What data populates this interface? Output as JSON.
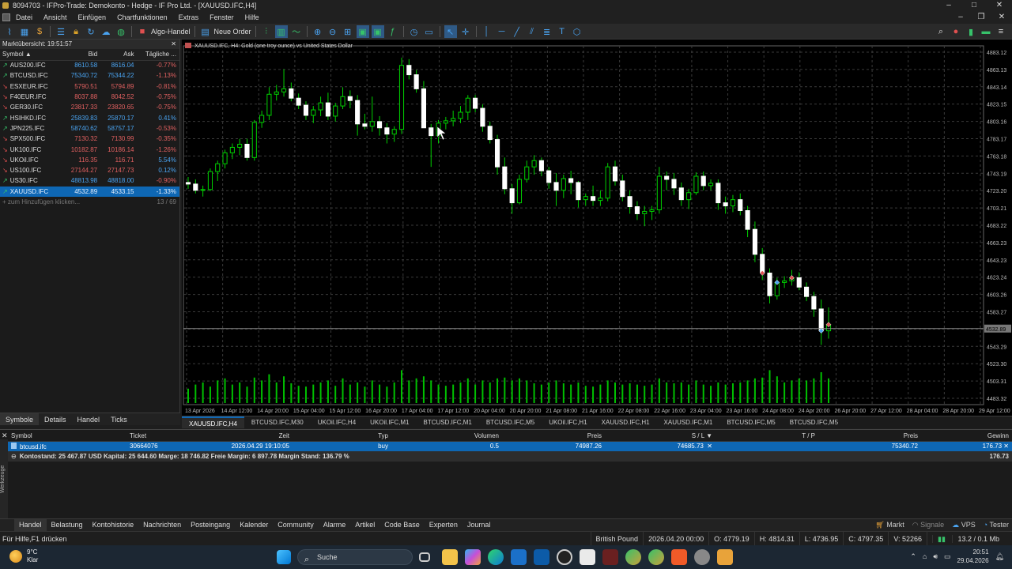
{
  "window": {
    "title": "8094703 - IFPro-Trade: Demokonto - Hedge - IF Pro Ltd. - [XAUUSD.IFC,H4]",
    "controls": [
      "–",
      "□",
      "✕"
    ]
  },
  "menu": {
    "items": [
      "Datei",
      "Ansicht",
      "Einfügen",
      "Chartfunktionen",
      "Extras",
      "Fenster",
      "Hilfe"
    ]
  },
  "toolbar": {
    "algo_label": "Algo-Handel",
    "order_label": "Neue Order"
  },
  "market_watch": {
    "header": "Marktübersicht: 19:51:57",
    "columns": [
      "Symbol",
      "Bid",
      "Ask",
      "Tägliche ..."
    ],
    "rows": [
      {
        "symbol": "AUS200.IFC",
        "bid": "8610.58",
        "ask": "8616.04",
        "change": "-0.77%",
        "dir": "up",
        "cdir": "dn"
      },
      {
        "symbol": "BTCUSD.IFC",
        "bid": "75340.72",
        "ask": "75344.22",
        "change": "-1.13%",
        "dir": "up",
        "cdir": "dn"
      },
      {
        "symbol": "ESXEUR.IFC",
        "bid": "5790.51",
        "ask": "5794.89",
        "change": "-0.81%",
        "dir": "dn",
        "cdir": "dn"
      },
      {
        "symbol": "F40EUR.IFC",
        "bid": "8037.88",
        "ask": "8042.52",
        "change": "-0.75%",
        "dir": "dn",
        "cdir": "dn"
      },
      {
        "symbol": "GER30.IFC",
        "bid": "23817.33",
        "ask": "23820.65",
        "change": "-0.75%",
        "dir": "dn",
        "cdir": "dn"
      },
      {
        "symbol": "HSIHKD.IFC",
        "bid": "25839.83",
        "ask": "25870.17",
        "change": "0.41%",
        "dir": "nn",
        "cdir": "up"
      },
      {
        "symbol": "JPN225.IFC",
        "bid": "58740.62",
        "ask": "58757.17",
        "change": "-0.53%",
        "dir": "up",
        "cdir": "dn"
      },
      {
        "symbol": "SPX500.IFC",
        "bid": "7130.32",
        "ask": "7130.99",
        "change": "-0.35%",
        "dir": "dn",
        "cdir": "dn"
      },
      {
        "symbol": "UK100.IFC",
        "bid": "10182.87",
        "ask": "10186.14",
        "change": "-1.26%",
        "dir": "dn",
        "cdir": "dn"
      },
      {
        "symbol": "UKOil.IFC",
        "bid": "116.35",
        "ask": "116.71",
        "change": "5.54%",
        "dir": "dn",
        "cdir": "up"
      },
      {
        "symbol": "US100.IFC",
        "bid": "27144.27",
        "ask": "27147.73",
        "change": "0.12%",
        "dir": "dn",
        "cdir": "up"
      },
      {
        "symbol": "US30.IFC",
        "bid": "48813.98",
        "ask": "48818.00",
        "change": "-0.90%",
        "dir": "up",
        "cdir": "dn"
      },
      {
        "symbol": "XAUUSD.IFC",
        "bid": "4532.89",
        "ask": "4533.15",
        "change": "-1.33%",
        "dir": "up",
        "cdir": "dn",
        "selected": true
      }
    ],
    "add_label": "+ zum Hinzufügen klicken...",
    "count": "13 / 69",
    "tabs": [
      "Symbole",
      "Details",
      "Handel",
      "Ticks"
    ]
  },
  "chart": {
    "header": "XAUUSD.IFC, H4:  Gold (one troy ounce) vs United States Dollar",
    "price_labels": [
      "4883.12",
      "4863.13",
      "4843.14",
      "4823.15",
      "4803.16",
      "4783.17",
      "4763.18",
      "4743.19",
      "4723.20",
      "4703.21",
      "4683.22",
      "4663.23",
      "4643.23",
      "4623.24",
      "4603.26",
      "4583.27",
      "4563.28",
      "4543.29",
      "4523.30",
      "4503.31",
      "4483.32"
    ],
    "current_price": "4532.89",
    "time_labels": [
      "13 Apr 2026",
      "14 Apr 12:00",
      "14 Apr 20:00",
      "15 Apr 04:00",
      "15 Apr 12:00",
      "16 Apr 20:00",
      "17 Apr 04:00",
      "17 Apr 12:00",
      "20 Apr 04:00",
      "20 Apr 20:00",
      "21 Apr 08:00",
      "21 Apr 16:00",
      "22 Apr 08:00",
      "22 Apr 16:00",
      "23 Apr 04:00",
      "23 Apr 16:00",
      "24 Apr 08:00",
      "24 Apr 20:00",
      "26 Apr 20:00",
      "27 Apr 12:00",
      "28 Apr 04:00",
      "28 Apr 20:00",
      "29 Apr 12:00"
    ],
    "tabs": [
      "XAUUSD.IFC,H4",
      "BTCUSD.IFC,M30",
      "UKOil.IFC,H4",
      "UKOil.IFC,M1",
      "BTCUSD.IFC,M1",
      "BTCUSD.IFC,M5",
      "UKOil.IFC,H1",
      "XAUUSD.IFC,H1",
      "XAUUSD.IFC,M1",
      "BTCUSD.IFC,M5",
      "BTCUSD.IFC,M5"
    ],
    "colors": {
      "bull": "#ffffff",
      "bear": "#ffffff",
      "wick": "#00d000",
      "grid": "#3a3a3a",
      "volume": "#00c000"
    }
  },
  "chart_data": {
    "type": "candlestick",
    "symbol": "XAUUSD.IFC",
    "timeframe": "H4",
    "ylim": [
      4478,
      4893
    ],
    "candles": [
      [
        4720,
        4727,
        4712,
        4718
      ],
      [
        4718,
        4724,
        4706,
        4710
      ],
      [
        4710,
        4716,
        4702,
        4711
      ],
      [
        4711,
        4738,
        4709,
        4734
      ],
      [
        4734,
        4748,
        4722,
        4744
      ],
      [
        4744,
        4762,
        4738,
        4758
      ],
      [
        4758,
        4770,
        4750,
        4765
      ],
      [
        4765,
        4776,
        4755,
        4769
      ],
      [
        4769,
        4776,
        4748,
        4752
      ],
      [
        4752,
        4800,
        4748,
        4797
      ],
      [
        4797,
        4812,
        4790,
        4806
      ],
      [
        4806,
        4842,
        4800,
        4833
      ],
      [
        4833,
        4845,
        4825,
        4836
      ],
      [
        4836,
        4865,
        4830,
        4840
      ],
      [
        4840,
        4848,
        4824,
        4828
      ],
      [
        4828,
        4834,
        4814,
        4819
      ],
      [
        4819,
        4824,
        4800,
        4806
      ],
      [
        4806,
        4818,
        4796,
        4813
      ],
      [
        4813,
        4830,
        4805,
        4822
      ],
      [
        4822,
        4835,
        4800,
        4805
      ],
      [
        4805,
        4822,
        4798,
        4818
      ],
      [
        4818,
        4842,
        4814,
        4830
      ],
      [
        4830,
        4838,
        4815,
        4825
      ],
      [
        4825,
        4832,
        4780,
        4795
      ],
      [
        4795,
        4808,
        4788,
        4792
      ],
      [
        4792,
        4830,
        4785,
        4798
      ],
      [
        4798,
        4805,
        4780,
        4790
      ],
      [
        4790,
        4796,
        4770,
        4782
      ],
      [
        4782,
        4792,
        4772,
        4788
      ],
      [
        4788,
        4880,
        4782,
        4870
      ],
      [
        4870,
        4878,
        4852,
        4858
      ],
      [
        4858,
        4864,
        4835,
        4840
      ],
      [
        4840,
        4850,
        4800,
        4790
      ],
      [
        4790,
        4795,
        4740,
        4780
      ],
      [
        4780,
        4800,
        4770,
        4796
      ],
      [
        4796,
        4804,
        4788,
        4799
      ],
      [
        4799,
        4812,
        4792,
        4802
      ],
      [
        4802,
        4818,
        4796,
        4810
      ],
      [
        4810,
        4832,
        4800,
        4828
      ],
      [
        4828,
        4832,
        4810,
        4815
      ],
      [
        4815,
        4820,
        4785,
        4792
      ],
      [
        4792,
        4798,
        4770,
        4775
      ],
      [
        4775,
        4781,
        4730,
        4740
      ],
      [
        4740,
        4752,
        4705,
        4712
      ],
      [
        4712,
        4718,
        4680,
        4694
      ],
      [
        4694,
        4730,
        4692,
        4724
      ],
      [
        4724,
        4748,
        4720,
        4740
      ],
      [
        4740,
        4755,
        4730,
        4748
      ],
      [
        4748,
        4752,
        4728,
        4735
      ],
      [
        4735,
        4740,
        4712,
        4720
      ],
      [
        4720,
        4732,
        4690,
        4710
      ],
      [
        4710,
        4730,
        4700,
        4725
      ],
      [
        4725,
        4735,
        4705,
        4720
      ],
      [
        4720,
        4722,
        4688,
        4698
      ],
      [
        4698,
        4706,
        4690,
        4702
      ],
      [
        4702,
        4716,
        4690,
        4697
      ],
      [
        4697,
        4710,
        4690,
        4700
      ],
      [
        4700,
        4745,
        4696,
        4740
      ],
      [
        4740,
        4748,
        4716,
        4722
      ],
      [
        4722,
        4730,
        4696,
        4702
      ],
      [
        4702,
        4710,
        4680,
        4689
      ],
      [
        4689,
        4696,
        4672,
        4680
      ],
      [
        4680,
        4690,
        4664,
        4683
      ],
      [
        4683,
        4690,
        4672,
        4685
      ],
      [
        4685,
        4740,
        4680,
        4728
      ],
      [
        4728,
        4734,
        4710,
        4724
      ],
      [
        4724,
        4732,
        4704,
        4713
      ],
      [
        4713,
        4720,
        4690,
        4698
      ],
      [
        4698,
        4712,
        4686,
        4707
      ],
      [
        4707,
        4733,
        4704,
        4728
      ],
      [
        4728,
        4734,
        4710,
        4716
      ],
      [
        4716,
        4724,
        4710,
        4719
      ],
      [
        4719,
        4724,
        4685,
        4694
      ],
      [
        4694,
        4702,
        4680,
        4690
      ],
      [
        4690,
        4704,
        4682,
        4698
      ],
      [
        4698,
        4706,
        4678,
        4684
      ],
      [
        4684,
        4690,
        4650,
        4660
      ],
      [
        4660,
        4670,
        4618,
        4628
      ],
      [
        4628,
        4636,
        4595,
        4604
      ],
      [
        4604,
        4610,
        4565,
        4575
      ],
      [
        4575,
        4598,
        4570,
        4592
      ],
      [
        4592,
        4600,
        4585,
        4594
      ],
      [
        4594,
        4608,
        4588,
        4598
      ],
      [
        4598,
        4605,
        4582,
        4586
      ],
      [
        4586,
        4592,
        4568,
        4574
      ],
      [
        4574,
        4580,
        4548,
        4558
      ],
      [
        4558,
        4570,
        4512,
        4530
      ],
      [
        4530,
        4560,
        4520,
        4538
      ]
    ],
    "volumes": [
      0.35,
      0.45,
      0.5,
      0.4,
      0.55,
      0.6,
      0.45,
      0.5,
      0.4,
      0.62,
      0.55,
      0.7,
      0.5,
      0.65,
      0.48,
      0.42,
      0.4,
      0.45,
      0.5,
      0.55,
      0.42,
      0.6,
      0.45,
      0.5,
      0.4,
      0.55,
      0.45,
      0.4,
      0.5,
      0.8,
      0.55,
      0.6,
      0.65,
      0.55,
      0.45,
      0.42,
      0.45,
      0.5,
      0.6,
      0.45,
      0.55,
      0.5,
      0.6,
      0.62,
      0.55,
      0.6,
      0.55,
      0.48,
      0.45,
      0.5,
      0.55,
      0.48,
      0.45,
      0.5,
      0.42,
      0.4,
      0.45,
      0.55,
      0.5,
      0.45,
      0.48,
      0.45,
      0.42,
      0.45,
      0.6,
      0.5,
      0.48,
      0.5,
      0.45,
      0.55,
      0.45,
      0.42,
      0.5,
      0.45,
      0.48,
      0.5,
      0.55,
      0.6,
      0.62,
      0.8,
      0.65,
      0.5,
      0.55,
      0.6,
      0.55,
      0.6,
      0.75,
      0.6
    ]
  },
  "trade": {
    "columns": [
      "Symbol",
      "Ticket",
      "Zeit",
      "Typ",
      "Volumen",
      "Preis",
      "S / L",
      "T / P",
      "Preis",
      "Gewinn"
    ],
    "position": {
      "symbol": "btcusd.ifc",
      "ticket": "30664076",
      "time": "2026.04.29 19:10:05",
      "type": "buy",
      "volume": "0.5",
      "price": "74987.26",
      "sl": "74685.73",
      "tp": "",
      "current": "75340.72",
      "profit": "176.73"
    },
    "balance_text": "Kontostand: 25 467.87 USD  Kapital: 25 644.60  Marge: 18 746.82  Freie Margin: 6 897.78  Margin Stand: 136.79 %",
    "balance_profit": "176.73",
    "side_label": "Werkzeuge"
  },
  "bottom_tabs": [
    "Handel",
    "Belastung",
    "Kontohistorie",
    "Nachrichten",
    "Posteingang",
    "Kalender",
    "Community",
    "Alarme",
    "Artikel",
    "Code Base",
    "Experten",
    "Journal"
  ],
  "bottom_right": [
    "Markt",
    "Signale",
    "VPS",
    "Tester"
  ],
  "status": {
    "help": "Für Hilfe,F1 drücken",
    "profile": "British Pound",
    "time": "2026.04.20 00:00",
    "open": "O: 4779.19",
    "high": "H: 4814.31",
    "low": "L: 4736.95",
    "close": "C: 4797.35",
    "volume": "V: 52266",
    "traffic": "13.2 / 0.1 Mb"
  },
  "taskbar": {
    "temp": "9°C",
    "weather": "Klar",
    "search": "Suche",
    "time": "20:51",
    "date": "29.04.2026"
  }
}
